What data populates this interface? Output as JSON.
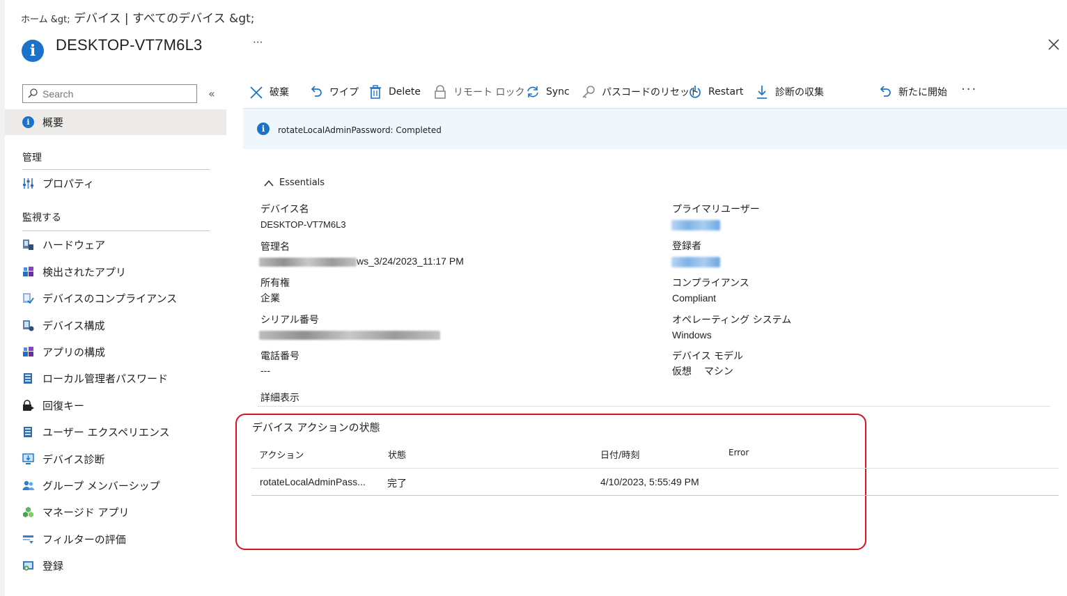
{
  "breadcrumb": {
    "home": "ホーム &gt;",
    "path": " デバイス | すべてのデバイス &gt;"
  },
  "header": {
    "title": "DESKTOP-VT7M6L3",
    "more": "···"
  },
  "sidebar": {
    "search_placeholder": "Search",
    "collapse": "«",
    "overview": "概要",
    "section_manage": "管理",
    "properties": "プロパティ",
    "section_monitor": "監視する",
    "items": [
      {
        "label": "ハードウェア",
        "icon": "hardware-icon"
      },
      {
        "label": "検出されたアプリ",
        "icon": "apps-icon"
      },
      {
        "label": "デバイスのコンプライアンス",
        "icon": "compliance-icon"
      },
      {
        "label": "デバイス構成",
        "icon": "device-config-icon"
      },
      {
        "label": "アプリの構成",
        "icon": "app-config-icon"
      },
      {
        "label": "ローカル管理者パスワード",
        "icon": "laps-icon"
      },
      {
        "label": "回復キー",
        "icon": "recovery-key-icon"
      },
      {
        "label": "ユーザー エクスペリエンス",
        "icon": "user-experience-icon"
      },
      {
        "label": "デバイス診断",
        "icon": "diagnostics-icon"
      },
      {
        "label": "グループ メンバーシップ",
        "icon": "group-icon"
      },
      {
        "label": "マネージド アプリ",
        "icon": "managed-apps-icon"
      },
      {
        "label": "フィルターの評価",
        "icon": "filter-icon"
      },
      {
        "label": "登録",
        "icon": "enrollment-icon"
      }
    ]
  },
  "toolbar": {
    "retire": "破棄",
    "wipe": "ワイプ",
    "delete": "Delete",
    "remote_lock": "リモート ロック",
    "sync": "Sync",
    "reset_passcode": "パスコードのリセット",
    "restart": "Restart",
    "collect_diagnostics": "診断の収集",
    "fresh_start": "新たに開始",
    "more": "···"
  },
  "banner": {
    "text": "rotateLocalAdminPassword: Completed"
  },
  "essentials": {
    "label": "Essentials",
    "device_name_label": "デバイス名",
    "device_name": "DESKTOP-VT7M6L3",
    "management_name_label": "管理名",
    "management_name_suffix": "ws_3/24/2023_11:17 PM",
    "ownership_label": "所有権",
    "ownership": "企業",
    "serial_label": "シリアル番号",
    "phone_label": "電話番号",
    "phone": "---",
    "primary_user_label": "プライマリユーザー",
    "enrolled_by_label": "登録者",
    "compliance_label": "コンプライアンス",
    "compliance": "Compliant",
    "os_label": "オペレーティング システム",
    "os": "Windows",
    "model_label": "デバイス モデル",
    "model": "仮想　 マシン",
    "see_more": "詳細表示"
  },
  "action_status": {
    "title": "デバイス アクションの状態",
    "columns": [
      "アクション",
      "状態",
      "日付/時刻",
      "Error"
    ],
    "rows": [
      {
        "action": "rotateLocalAdminPass...",
        "status": "完了",
        "datetime": "4/10/2023, 5:55:49 PM",
        "error": ""
      }
    ]
  },
  "colors": {
    "accent": "#1a73c8",
    "highlight": "#d9121e",
    "banner_bg": "#eff6fc"
  }
}
